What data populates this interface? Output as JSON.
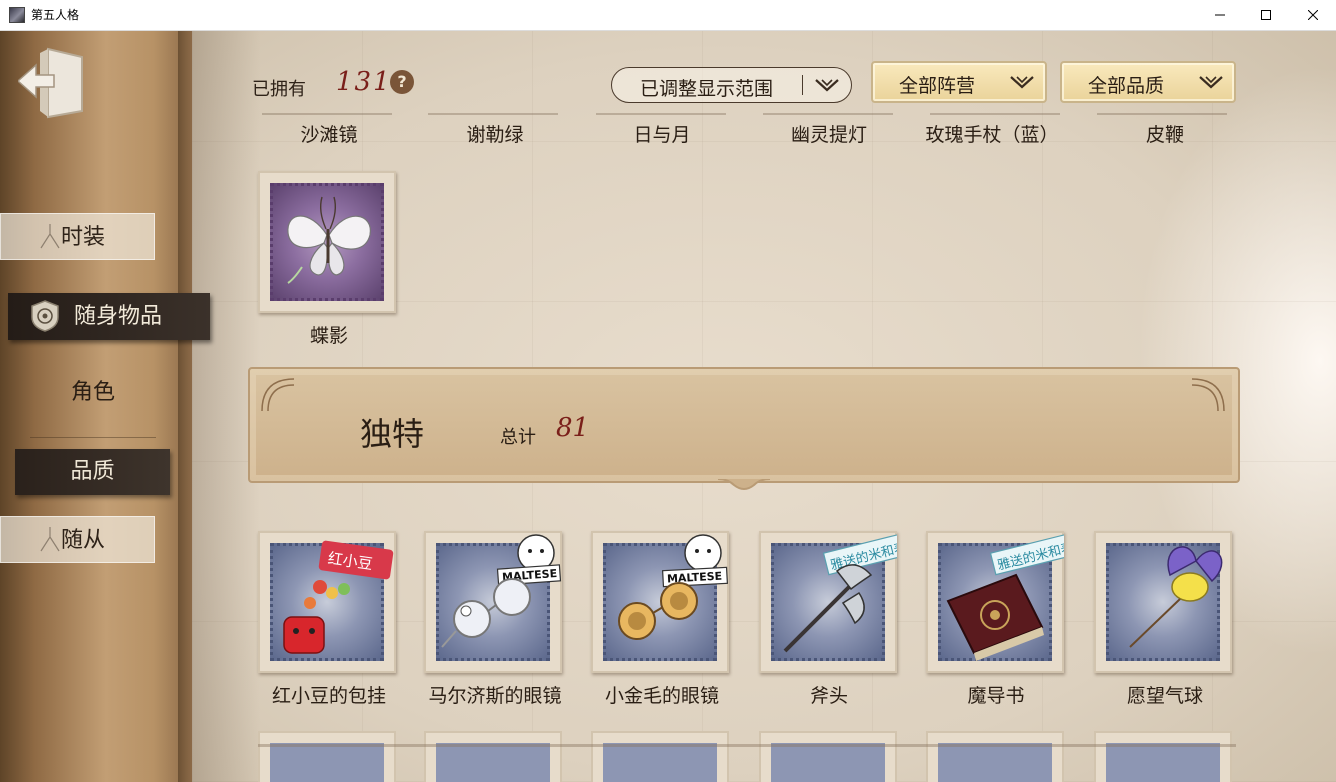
{
  "window": {
    "title": "第五人格",
    "controls": [
      "minimize",
      "maximize",
      "close"
    ]
  },
  "sidebar": {
    "back_icon": "exit-door-icon",
    "tabs": [
      {
        "label": "时装",
        "state": "inactive"
      },
      {
        "label": "随身物品",
        "state": "active",
        "icon": "emblem-icon"
      },
      {
        "label": "角色",
        "state": "plain"
      },
      {
        "label": "品质",
        "state": "selected"
      },
      {
        "label": "随从",
        "state": "inactive"
      }
    ]
  },
  "header": {
    "owned_label": "已拥有",
    "owned_count": "131",
    "help_symbol": "?",
    "filters": [
      {
        "label": "已调整显示范围",
        "icon": "chevron-down-icon"
      },
      {
        "label": "全部阵营",
        "icon": "chevron-down-icon"
      },
      {
        "label": "全部品质",
        "icon": "chevron-down-icon"
      }
    ]
  },
  "top_row_names": [
    "沙滩镜",
    "谢勒绿",
    "日与月",
    "幽灵提灯",
    "玫瑰手杖（蓝）",
    "皮鞭"
  ],
  "rare_items": [
    {
      "name": "蝶影",
      "frame": "purple",
      "art": "white-butterfly"
    }
  ],
  "unique_section": {
    "title": "独特",
    "total_label": "总计",
    "total_count": "81"
  },
  "unique_items": [
    {
      "name": "红小豆的包挂",
      "frame": "blue",
      "art": "red-keychain",
      "tag": "红小豆"
    },
    {
      "name": "马尔济斯的眼镜",
      "frame": "blue",
      "art": "glasses-silver",
      "tag": "MALTESE"
    },
    {
      "name": "小金毛的眼镜",
      "frame": "blue",
      "art": "glasses-gold",
      "tag": "MALTESE"
    },
    {
      "name": "斧头",
      "frame": "blue",
      "art": "axe",
      "tag": "雅送的米和表"
    },
    {
      "name": "魔导书",
      "frame": "blue",
      "art": "grimoire",
      "tag": "雅送的米和表"
    },
    {
      "name": "愿望气球",
      "frame": "blue",
      "art": "butterfly-balloon"
    }
  ],
  "colors": {
    "accent_red": "#7a1f1a",
    "panel_dark": "#2a211b",
    "dropdown_gold": "#f2dfaa"
  }
}
